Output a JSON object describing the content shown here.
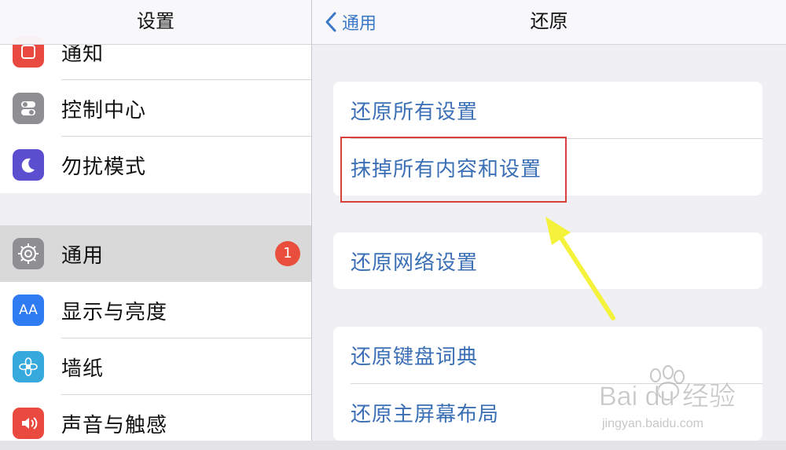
{
  "master": {
    "title": "设置",
    "items": [
      {
        "label": "通知",
        "icon": "notifications-icon",
        "color": "#e9493f"
      },
      {
        "label": "控制中心",
        "icon": "control-center-icon",
        "color": "#8e8e93"
      },
      {
        "label": "勿扰模式",
        "icon": "moon-icon",
        "color": "#5b4fcf"
      },
      {
        "label": "通用",
        "icon": "gear-icon",
        "color": "#8e8e93",
        "badge": "1",
        "selected": true
      },
      {
        "label": "显示与亮度",
        "icon": "display-brightness-icon",
        "color": "#2f7bf2",
        "icon_text": "AA"
      },
      {
        "label": "墙纸",
        "icon": "wallpaper-flower-icon",
        "color": "#36aadc"
      },
      {
        "label": "声音与触感",
        "icon": "speaker-icon",
        "color": "#e9493f"
      }
    ]
  },
  "detail": {
    "title": "还原",
    "back_label": "通用",
    "groups": [
      {
        "items": [
          "还原所有设置",
          "抹掉所有内容和设置"
        ]
      },
      {
        "items": [
          "还原网络设置"
        ]
      },
      {
        "items": [
          "还原键盘词典",
          "还原主屏幕布局"
        ]
      }
    ]
  },
  "annotation": {
    "highlight_color": "#d8403a",
    "arrow_color": "#f4f23a"
  },
  "watermark": {
    "brand": "Bai du 经验",
    "url": "jingyan.baidu.com"
  },
  "colors": {
    "accent": "#3a6fb6",
    "badge": "#e84e3b",
    "background": "#efeff4"
  }
}
